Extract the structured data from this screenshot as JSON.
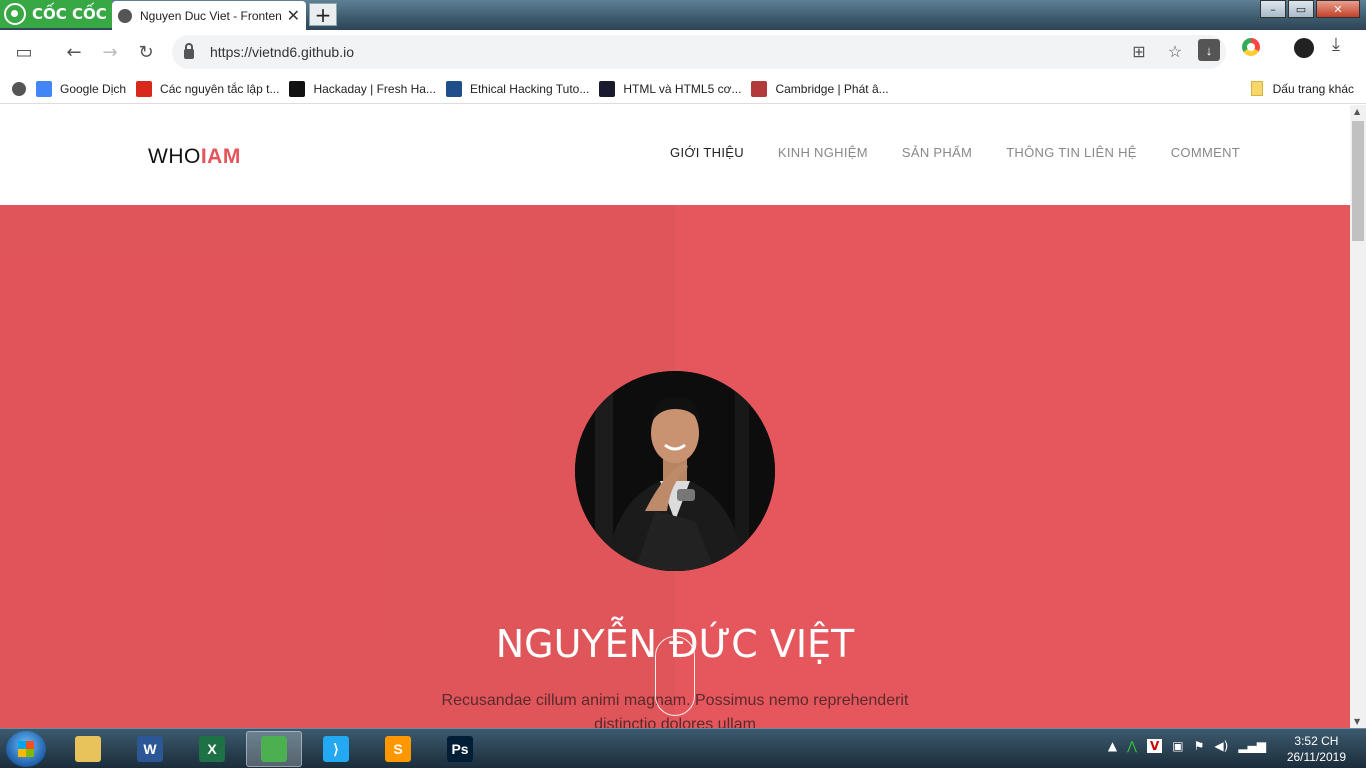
{
  "browser": {
    "brand_name": "CỐC CỐC",
    "tab_title": "Nguyen Duc Viet - Frontend",
    "url": "https://vietnd6.github.io",
    "new_tab_label": "+",
    "window_controls": {
      "minimize": "–",
      "maximize": "▭",
      "close": "✕"
    }
  },
  "bookmarks": {
    "items": [
      {
        "label": "Google Dịch",
        "icon": "google-translate-icon",
        "color": "#4285f4"
      },
      {
        "label": "Các nguyên tắc lập t...",
        "icon": "t-icon",
        "color": "#d9291c"
      },
      {
        "label": "Hackaday | Fresh Ha...",
        "icon": "hackaday-icon",
        "color": "#111111"
      },
      {
        "label": "Ethical Hacking Tuto...",
        "icon": "tutorialspoint-icon",
        "color": "#1f4e8c"
      },
      {
        "label": "HTML và HTML5 cơ...",
        "icon": "code-icon",
        "color": "#1a1a2e"
      },
      {
        "label": "Cambridge | Phát â...",
        "icon": "cambridge-icon",
        "color": "#b33a3a"
      }
    ],
    "other_label": "Dấu trang khác"
  },
  "site": {
    "logo_part1": "WHO",
    "logo_part2": "IAM",
    "nav": [
      {
        "label": "GIỚI THIỆU",
        "active": true
      },
      {
        "label": "KINH NGHIỆM",
        "active": false
      },
      {
        "label": "SẢN PHẨM",
        "active": false
      },
      {
        "label": "THÔNG TIN LIÊN HỆ",
        "active": false
      },
      {
        "label": "COMMENT",
        "active": false
      }
    ],
    "hero": {
      "name": "NGUYỄN ĐỨC VIỆT",
      "description_line1": "Recusandae cillum animi magnam. Possimus nemo reprehenderit",
      "description_line2": "distinctio dolores ullam",
      "background_color": "#e5575c"
    }
  },
  "taskbar": {
    "apps": [
      {
        "icon": "file-explorer-icon",
        "letter": "",
        "color": "#e8c25a"
      },
      {
        "icon": "word-icon",
        "letter": "W",
        "color": "#2b5797"
      },
      {
        "icon": "excel-icon",
        "letter": "X",
        "color": "#1e7145"
      },
      {
        "icon": "coccoc-browser-icon",
        "letter": "",
        "color": "#4caf50",
        "active": true
      },
      {
        "icon": "vscode-icon",
        "letter": "⟩",
        "color": "#23a9f2"
      },
      {
        "icon": "sublime-text-icon",
        "letter": "S",
        "color": "#ff9800"
      },
      {
        "icon": "photoshop-icon",
        "letter": "Ps",
        "color": "#001e36"
      }
    ],
    "time": "3:52 CH",
    "date": "26/11/2019"
  }
}
